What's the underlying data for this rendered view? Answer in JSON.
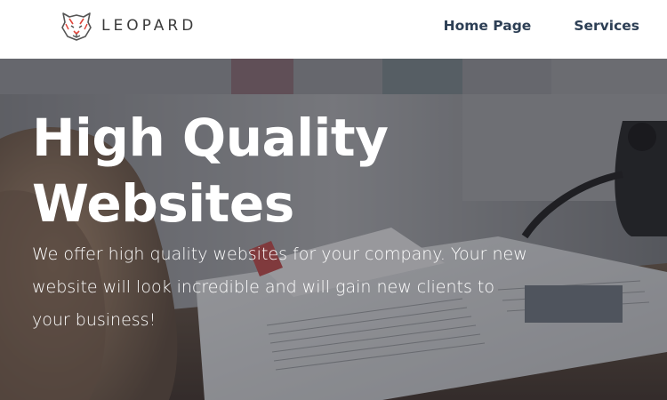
{
  "header": {
    "logo_text": "LEOPARD",
    "logo_icon": "leopard-head-icon",
    "nav": [
      {
        "label": "Home Page"
      },
      {
        "label": "Services"
      }
    ]
  },
  "hero": {
    "title": "High Quality Websites",
    "description": "We offer high quality websites for your company. Your new website will look incredible and will gain new clients to your business!"
  },
  "colors": {
    "nav_text": "#2d3f55",
    "logo_text": "#3b3b3b",
    "logo_accent": "#e0453a",
    "hero_text": "#ffffff"
  }
}
